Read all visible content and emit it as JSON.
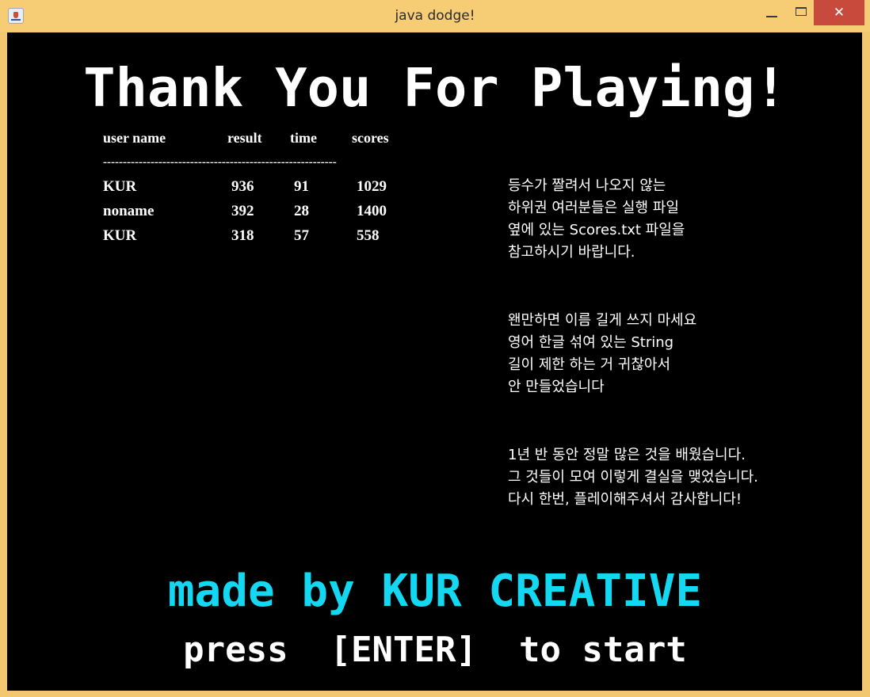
{
  "window": {
    "title": "java dodge!",
    "close_glyph": "✕"
  },
  "game": {
    "headline": "Thank You For Playing!",
    "table": {
      "headers": {
        "name": "user name",
        "result": "result",
        "time": "time",
        "scores": "scores"
      },
      "divider": "-----------------------------------------------------------",
      "rows": [
        {
          "name": "KUR",
          "result": "936",
          "time": "91",
          "scores": "1029"
        },
        {
          "name": "noname",
          "result": "392",
          "time": "28",
          "scores": "1400"
        },
        {
          "name": "KUR",
          "result": "318",
          "time": "57",
          "scores": "558"
        }
      ]
    },
    "notes": [
      [
        "등수가 짤려서 나오지 않는",
        "하위권 여러분들은 실행 파일",
        "옆에 있는 Scores.txt 파일을",
        "참고하시기 바랍니다."
      ],
      [
        "왠만하면 이름 길게 쓰지 마세요",
        "영어 한글 섞여 있는 String",
        "길이 제한 하는 거 귀찮아서",
        "안 만들었습니다"
      ],
      [
        "1년 반 동안 정말 많은 것을 배웠습니다.",
        "그 것들이 모여 이렇게 결실을 맺었습니다.",
        "다시 한번, 플레이해주셔서 감사합니다!"
      ]
    ],
    "credit": "made by KUR CREATIVE",
    "prompt": "press  [ENTER]  to start"
  },
  "colors": {
    "background": "#000000",
    "text": "#ffffff",
    "credit": "#14d8f2",
    "window_frame": "#f3c76f",
    "close_button": "#c74a3c"
  }
}
